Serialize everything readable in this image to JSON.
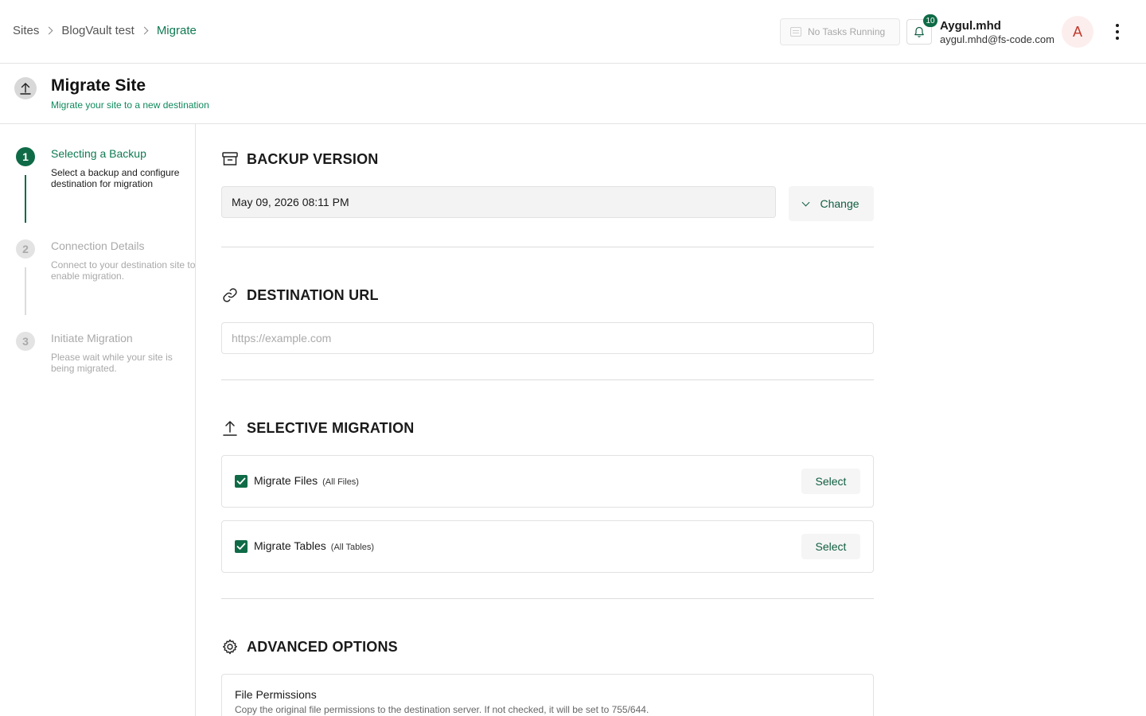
{
  "breadcrumb": {
    "items": [
      "Sites",
      "BlogVault test"
    ],
    "current": "Migrate"
  },
  "header": {
    "tasks_label": "No Tasks Running",
    "notifications_count": "10",
    "user_name": "Aygul.mhd",
    "user_email": "aygul.mhd@fs-code.com",
    "avatar_letter": "A"
  },
  "page": {
    "title": "Migrate Site",
    "subtitle": "Migrate your site to a new destination"
  },
  "steps": [
    {
      "num": "1",
      "title": "Selecting a Backup",
      "desc": "Select a backup and configure destination for migration",
      "state": "active"
    },
    {
      "num": "2",
      "title": "Connection Details",
      "desc": "Connect to your destination site to enable migration.",
      "state": "inactive"
    },
    {
      "num": "3",
      "title": "Initiate Migration",
      "desc": "Please wait while your site is being migrated.",
      "state": "inactive"
    }
  ],
  "backup": {
    "heading": "BACKUP VERSION",
    "value": "May 09, 2026 08:11 PM",
    "change_label": "Change"
  },
  "destination": {
    "heading": "DESTINATION URL",
    "placeholder": "https://example.com"
  },
  "selective": {
    "heading": "SELECTIVE MIGRATION",
    "files_label": "Migrate Files",
    "files_note": "(All Files)",
    "tables_label": "Migrate Tables",
    "tables_note": "(All Tables)",
    "select_label": "Select"
  },
  "advanced": {
    "heading": "ADVANCED OPTIONS",
    "perm_title": "File Permissions",
    "perm_desc": "Copy the original file permissions to the destination server. If not checked, it will be set to 755/644."
  },
  "colors": {
    "accent": "#0f6b47",
    "accent_text": "#0f7a52",
    "avatar_bg": "#fdeeee",
    "avatar_fg": "#c0392b"
  }
}
